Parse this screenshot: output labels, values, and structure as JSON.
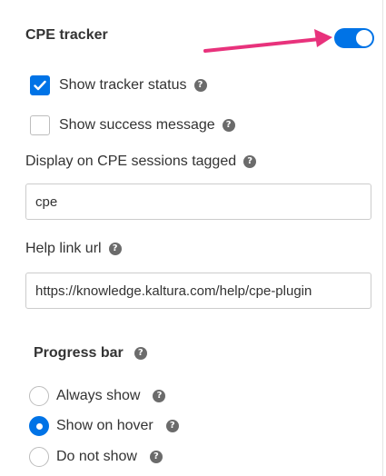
{
  "section": {
    "title": "CPE tracker",
    "enabled": true
  },
  "options": {
    "show_tracker_status": {
      "label": "Show tracker status",
      "checked": true
    },
    "show_success_message": {
      "label": "Show success message",
      "checked": false
    }
  },
  "tags_field": {
    "label": "Display on CPE sessions tagged",
    "value": "cpe"
  },
  "help_link_field": {
    "label": "Help link url",
    "value": "https://knowledge.kaltura.com/help/cpe-plugin"
  },
  "progress_bar": {
    "title": "Progress bar",
    "options": [
      {
        "label": "Always show",
        "selected": false
      },
      {
        "label": "Show on hover",
        "selected": true
      },
      {
        "label": "Do not show",
        "selected": false
      }
    ]
  },
  "colors": {
    "accent": "#0073e6",
    "annotation_arrow": "#e8327c"
  },
  "icons": {
    "help": "question-mark-circle-icon",
    "check": "checkmark-icon"
  }
}
